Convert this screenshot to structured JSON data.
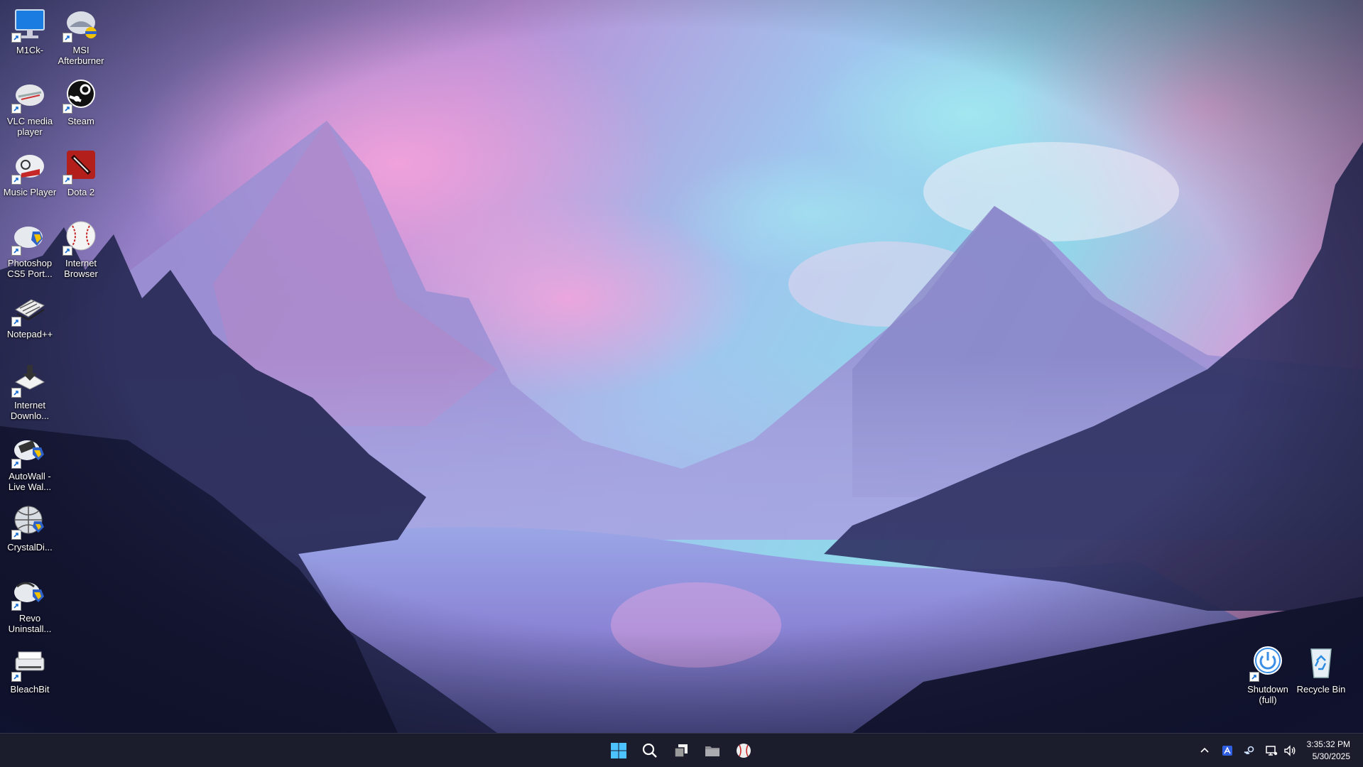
{
  "desktop": {
    "icons": [
      {
        "label": "M1Ck-"
      },
      {
        "label": "MSI Afterburner"
      },
      {
        "label": "VLC media player"
      },
      {
        "label": "Steam"
      },
      {
        "label": "Music Player"
      },
      {
        "label": "Dota 2"
      },
      {
        "label": "Photoshop CS5 Port..."
      },
      {
        "label": "Internet Browser"
      },
      {
        "label": "Notepad++"
      },
      {
        "label": "Internet Downlo..."
      },
      {
        "label": "AutoWall - Live Wal..."
      },
      {
        "label": "CrystalDi..."
      },
      {
        "label": "Revo Uninstall..."
      },
      {
        "label": "BleachBit"
      },
      {
        "label": "Shutdown (full)"
      },
      {
        "label": "Recycle Bin"
      }
    ]
  },
  "taskbar": {
    "pinned": [
      "start-icon",
      "search-icon",
      "task-view-icon",
      "file-explorer-icon",
      "baseball-browser-icon"
    ],
    "tray": [
      "chevron-up-icon",
      "app-a-icon",
      "steam-icon",
      "network-icon",
      "volume-icon"
    ],
    "clock": {
      "time": "3:35:32 PM",
      "date": "5/30/2025"
    }
  },
  "colors": {
    "taskbar_bg": "#1c1d2c",
    "windows_blue": "#4cc2ff",
    "sky_pink": "#e49ad8",
    "sky_cyan": "#7fd6ea"
  }
}
